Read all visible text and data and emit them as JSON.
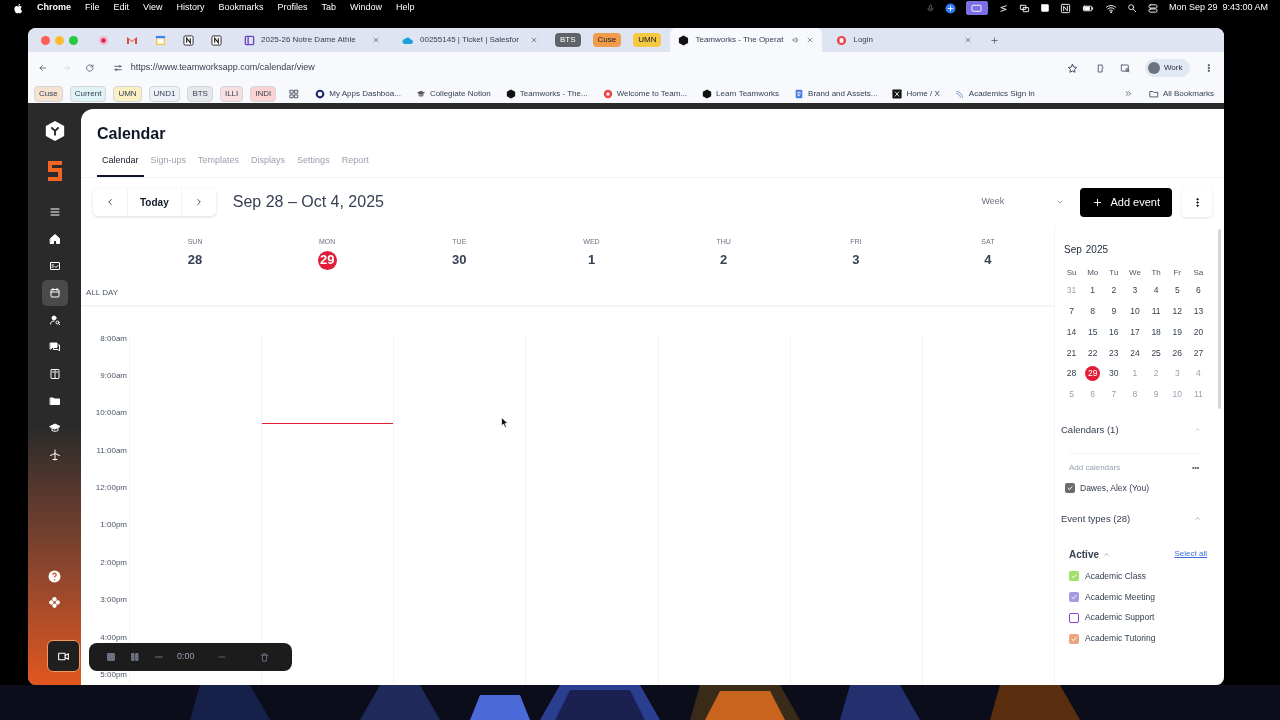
{
  "menubar": {
    "app": "Chrome",
    "menus": [
      "File",
      "Edit",
      "View",
      "History",
      "Bookmarks",
      "Profiles",
      "Tab",
      "Window",
      "Help"
    ],
    "clock": "Mon Sep 29  9:43:00 AM"
  },
  "tabs": [
    {
      "kind": "tab",
      "title": "2025-26 Notre Dame Athle",
      "selected": false
    },
    {
      "kind": "tab",
      "title": "00255145 | Ticket | Salesfor",
      "selected": false
    },
    {
      "kind": "group",
      "title": "BTS",
      "color": "#5f6368",
      "selected": false
    },
    {
      "kind": "group",
      "title": "Cuse",
      "color": "#f29b4b",
      "selected": false
    },
    {
      "kind": "group",
      "title": "UMN",
      "color": "#f5c842",
      "selected": false
    },
    {
      "kind": "tab",
      "title": "Teamworks - The Operat",
      "selected": true
    },
    {
      "kind": "tab",
      "title": "Login",
      "selected": false
    }
  ],
  "address": "https://www.teamworksapp.com/calendar/view",
  "profile": "Work",
  "bookmarks": [
    {
      "kind": "folder",
      "label": "Cuse",
      "color": "#f6e3cf"
    },
    {
      "kind": "folder",
      "label": "Current",
      "color": "#dff3f6"
    },
    {
      "kind": "folder",
      "label": "UMN",
      "color": "#fbf0c4"
    },
    {
      "kind": "folder",
      "label": "UND1",
      "color": "#eef1f8"
    },
    {
      "kind": "folder",
      "label": "BTS",
      "color": "#e6e8ec"
    },
    {
      "kind": "folder",
      "label": "ILLI",
      "color": "#f9e0e0"
    },
    {
      "kind": "folder",
      "label": "INDI",
      "color": "#fbd3d3"
    },
    {
      "kind": "link",
      "label": "My Apps Dashboa..."
    },
    {
      "kind": "link",
      "label": "Collegiate Notion"
    },
    {
      "kind": "link",
      "label": "Teamworks - The..."
    },
    {
      "kind": "link",
      "label": "Welcome to Team..."
    },
    {
      "kind": "link",
      "label": "Learn Teamworks"
    },
    {
      "kind": "link",
      "label": "Brand and Assets..."
    },
    {
      "kind": "link",
      "label": "Home / X"
    },
    {
      "kind": "link",
      "label": "Academics Sign in"
    }
  ],
  "all_bookmarks": "All Bookmarks",
  "sidebar_nav": [
    {
      "selected": false
    },
    {
      "selected": false
    },
    {
      "selected": false
    },
    {
      "selected": true
    },
    {
      "selected": false
    },
    {
      "selected": false
    },
    {
      "selected": false
    },
    {
      "selected": false
    },
    {
      "selected": false
    },
    {
      "selected": false
    }
  ],
  "page": {
    "title": "Calendar",
    "tabs": [
      {
        "label": "Calendar",
        "selected": true
      },
      {
        "label": "Sign-ups",
        "selected": false
      },
      {
        "label": "Templates",
        "selected": false
      },
      {
        "label": "Displays",
        "selected": false
      },
      {
        "label": "Settings",
        "selected": false
      },
      {
        "label": "Report",
        "selected": false
      }
    ],
    "today": "Today",
    "range": "Sep 28 – Oct 4, 2025",
    "view": "Week",
    "add_event": "Add event",
    "days": [
      {
        "dow": "SUN",
        "date": "28",
        "today": false
      },
      {
        "dow": "MON",
        "date": "29",
        "today": true
      },
      {
        "dow": "TUE",
        "date": "30",
        "today": false
      },
      {
        "dow": "WED",
        "date": "1",
        "today": false
      },
      {
        "dow": "THU",
        "date": "2",
        "today": false
      },
      {
        "dow": "FRI",
        "date": "3",
        "today": false
      },
      {
        "dow": "SAT",
        "date": "4",
        "today": false
      }
    ],
    "all_day": "ALL DAY",
    "hours": [
      "8:00am",
      "9:00am",
      "10:00am",
      "11:00am",
      "12:00pm",
      "1:00pm",
      "2:00pm",
      "3:00pm",
      "4:00pm",
      "5:00pm"
    ]
  },
  "mini_calendar": {
    "month": "Sep",
    "year": "2025",
    "weekdays": [
      "Su",
      "Mo",
      "Tu",
      "We",
      "Th",
      "Fr",
      "Sa"
    ],
    "days": [
      {
        "label": "31",
        "outside": true,
        "selected": false
      },
      {
        "label": "1",
        "outside": false,
        "selected": false
      },
      {
        "label": "2",
        "outside": false,
        "selected": false
      },
      {
        "label": "3",
        "outside": false,
        "selected": false
      },
      {
        "label": "4",
        "outside": false,
        "selected": false
      },
      {
        "label": "5",
        "outside": false,
        "selected": false
      },
      {
        "label": "6",
        "outside": false,
        "selected": false
      },
      {
        "label": "7",
        "outside": false,
        "selected": false
      },
      {
        "label": "8",
        "outside": false,
        "selected": false
      },
      {
        "label": "9",
        "outside": false,
        "selected": false
      },
      {
        "label": "10",
        "outside": false,
        "selected": false
      },
      {
        "label": "11",
        "outside": false,
        "selected": false
      },
      {
        "label": "12",
        "outside": false,
        "selected": false
      },
      {
        "label": "13",
        "outside": false,
        "selected": false
      },
      {
        "label": "14",
        "outside": false,
        "selected": false
      },
      {
        "label": "15",
        "outside": false,
        "selected": false
      },
      {
        "label": "16",
        "outside": false,
        "selected": false
      },
      {
        "label": "17",
        "outside": false,
        "selected": false
      },
      {
        "label": "18",
        "outside": false,
        "selected": false
      },
      {
        "label": "19",
        "outside": false,
        "selected": false
      },
      {
        "label": "20",
        "outside": false,
        "selected": false
      },
      {
        "label": "21",
        "outside": false,
        "selected": false
      },
      {
        "label": "22",
        "outside": false,
        "selected": false
      },
      {
        "label": "23",
        "outside": false,
        "selected": false
      },
      {
        "label": "24",
        "outside": false,
        "selected": false
      },
      {
        "label": "25",
        "outside": false,
        "selected": false
      },
      {
        "label": "26",
        "outside": false,
        "selected": false
      },
      {
        "label": "27",
        "outside": false,
        "selected": false
      },
      {
        "label": "28",
        "outside": false,
        "selected": false
      },
      {
        "label": "29",
        "outside": false,
        "selected": true
      },
      {
        "label": "30",
        "outside": false,
        "selected": false
      },
      {
        "label": "1",
        "outside": true,
        "selected": false
      },
      {
        "label": "2",
        "outside": true,
        "selected": false
      },
      {
        "label": "3",
        "outside": true,
        "selected": false
      },
      {
        "label": "4",
        "outside": true,
        "selected": false
      },
      {
        "label": "5",
        "outside": true,
        "selected": false
      },
      {
        "label": "6",
        "outside": true,
        "selected": false
      },
      {
        "label": "7",
        "outside": true,
        "selected": false
      },
      {
        "label": "8",
        "outside": true,
        "selected": false
      },
      {
        "label": "9",
        "outside": true,
        "selected": false
      },
      {
        "label": "10",
        "outside": true,
        "selected": false
      },
      {
        "label": "11",
        "outside": true,
        "selected": false
      }
    ]
  },
  "calendars": {
    "title": "Calendars (1)",
    "expanded": true,
    "placeholder": "Add calendars",
    "items": [
      {
        "label": "Dawes, Alex (You)",
        "checked": true
      }
    ]
  },
  "event_types": {
    "title": "Event types (28)",
    "expanded": true,
    "group": "Active",
    "group_expanded": true,
    "select_all": "Select all",
    "items": [
      {
        "label": "Academic Class",
        "checked": true,
        "color": "#a3e06a"
      },
      {
        "label": "Academic Meeting",
        "checked": true,
        "color": "#a49be0"
      },
      {
        "label": "Academic Support",
        "checked": false,
        "color": "#8b3fd9"
      },
      {
        "label": "Academic Tutoring",
        "checked": true,
        "color": "#eba57e"
      }
    ]
  },
  "recorder": {
    "time": "0:00"
  }
}
